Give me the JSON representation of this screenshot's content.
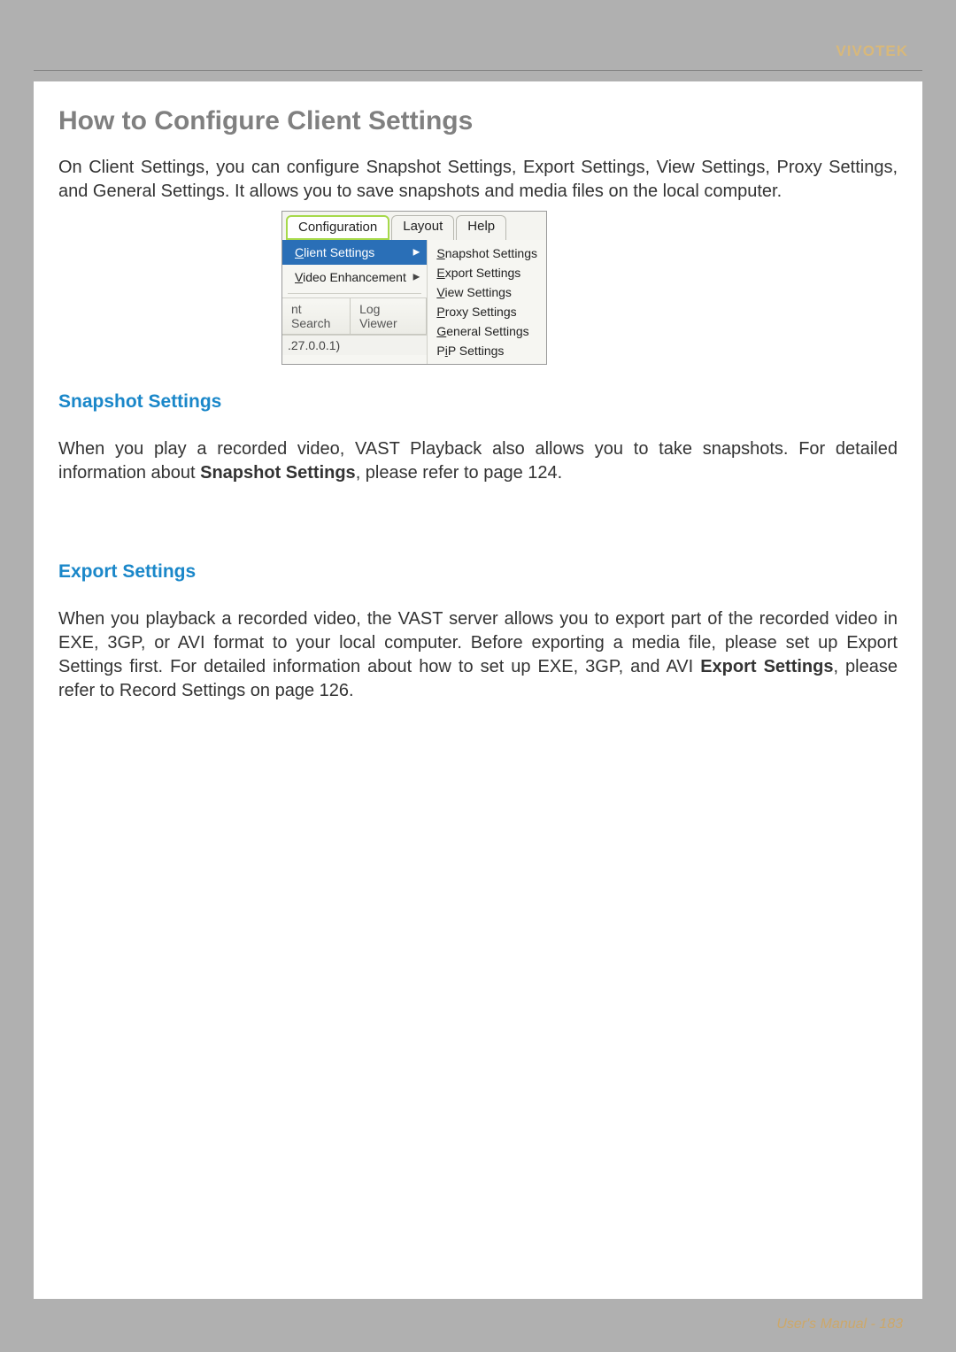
{
  "brand": "VIVOTEK",
  "title": "How to Configure Client Settings",
  "intro": "On Client Settings, you can configure Snapshot Settings, Export Settings, View Settings, Proxy Settings, and General Settings. It allows you to save snapshots and media files on the local computer.",
  "menu": {
    "tabs": {
      "configuration": "Configuration",
      "layout": "Layout",
      "help": "Help"
    },
    "left": {
      "client_settings": "Client Settings",
      "video_enhancement": "Video Enhancement"
    },
    "right": {
      "snapshot": "Snapshot Settings",
      "export": "Export Settings",
      "view": "View Settings",
      "proxy": "Proxy Settings",
      "general": "General Settings",
      "pip": "PiP Settings"
    },
    "toolbar": {
      "nt_search": "nt Search",
      "log_viewer": "Log Viewer"
    },
    "footer_ip": ".27.0.0.1)"
  },
  "sections": {
    "snapshot": {
      "heading": "Snapshot Settings",
      "text_a": "When you play a recorded video, VAST Playback also allows you to take snapshots. For detailed information about ",
      "text_b_bold": "Snapshot Settings",
      "text_c": ", please refer to page 124."
    },
    "export": {
      "heading": "Export Settings",
      "text_a": "When you playback a recorded video, the VAST server allows you to export part of the recorded video in EXE, 3GP, or AVI format to your local computer. Before exporting a media file, please set up Export Settings first. For detailed information about how to set up EXE, 3GP, and AVI ",
      "text_b_bold": "Export Settings",
      "text_c": ", please refer to Record Settings on page 126."
    }
  },
  "footer": {
    "label": "User's Manual - ",
    "page": "183"
  }
}
